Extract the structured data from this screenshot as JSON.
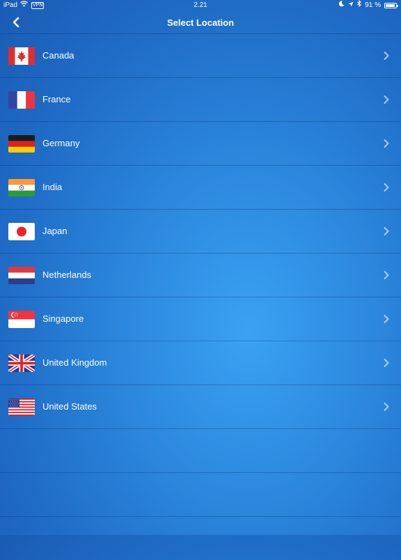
{
  "status_bar": {
    "device": "iPad",
    "vpn": "VPN",
    "time": "2.21",
    "battery": "91 %",
    "battery_level": 0.91
  },
  "nav": {
    "title": "Select Location"
  },
  "locations": [
    {
      "name": "Canada",
      "flag": "canada-flag"
    },
    {
      "name": "France",
      "flag": "france-flag"
    },
    {
      "name": "Germany",
      "flag": "germany-flag"
    },
    {
      "name": "India",
      "flag": "india-flag"
    },
    {
      "name": "Japan",
      "flag": "japan-flag"
    },
    {
      "name": "Netherlands",
      "flag": "netherlands-flag"
    },
    {
      "name": "Singapore",
      "flag": "singapore-flag"
    },
    {
      "name": "United Kingdom",
      "flag": "united-kingdom-flag"
    },
    {
      "name": "United States",
      "flag": "united-states-flag"
    }
  ]
}
